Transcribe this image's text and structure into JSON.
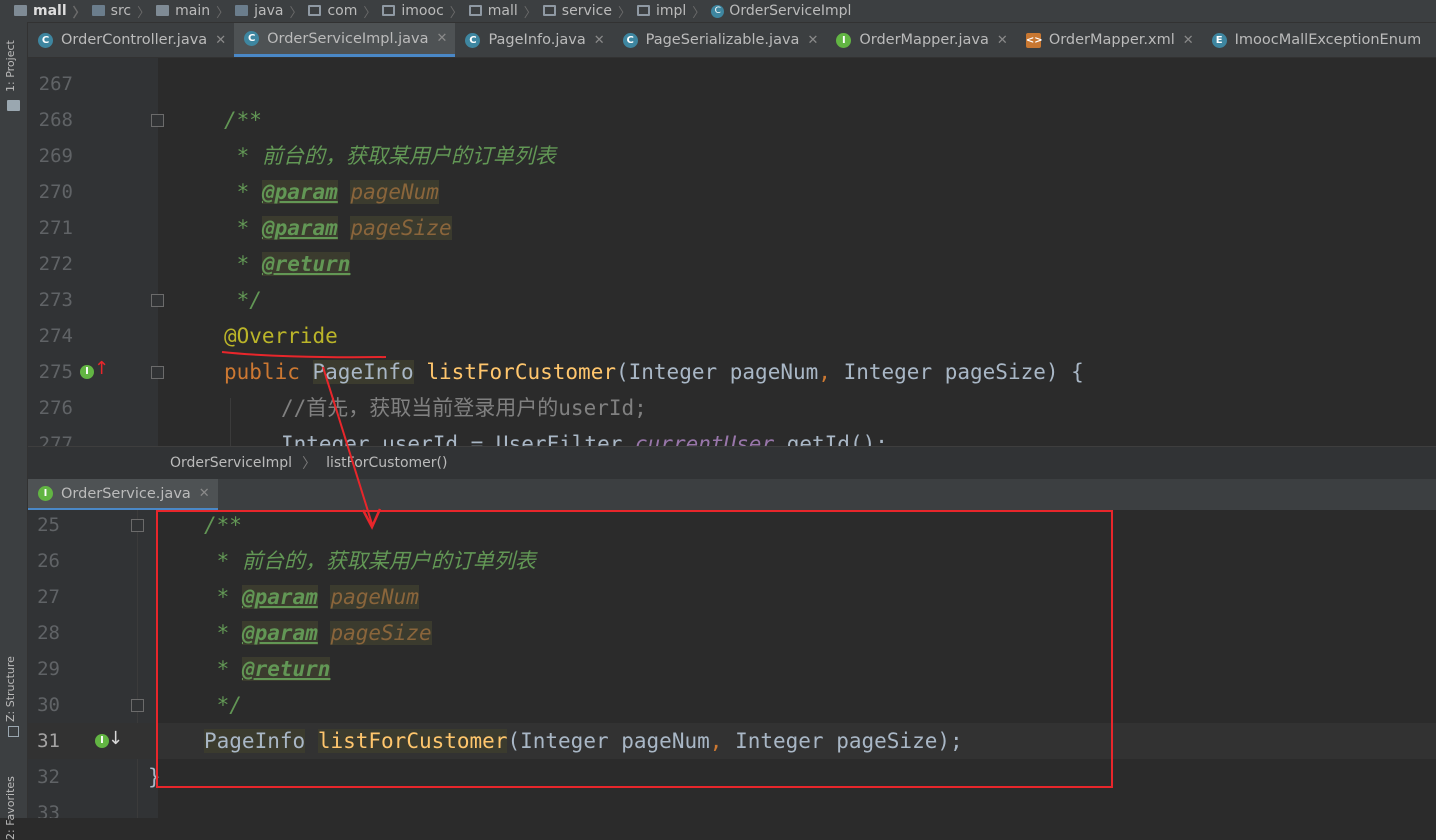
{
  "navbar": {
    "crumbs": [
      "mall",
      "src",
      "main",
      "java",
      "com",
      "imooc",
      "mall",
      "service",
      "impl",
      "OrderServiceImpl"
    ]
  },
  "toolstripe": {
    "project_label": "1: Project",
    "structure_label": "Z: Structure",
    "favorites_label": "2: Favorites"
  },
  "tabs": [
    {
      "label": "OrderController.java",
      "icon": "C"
    },
    {
      "label": "OrderServiceImpl.java",
      "icon": "C"
    },
    {
      "label": "PageInfo.java",
      "icon": "C"
    },
    {
      "label": "PageSerializable.java",
      "icon": "C"
    },
    {
      "label": "OrderMapper.java",
      "icon": "I"
    },
    {
      "label": "OrderMapper.xml",
      "icon": "X"
    },
    {
      "label": "ImoocMallExceptionEnum",
      "icon": "E"
    }
  ],
  "editor1": {
    "lines": [
      {
        "num": "267"
      },
      {
        "num": "268",
        "open": "/**"
      },
      {
        "num": "269",
        "star": " * ",
        "text": "前台的，获取某用户的订单列表"
      },
      {
        "num": "270",
        "star": " * ",
        "tag": "@param",
        "param": "pageNum"
      },
      {
        "num": "271",
        "star": " * ",
        "tag": "@param",
        "param": "pageSize"
      },
      {
        "num": "272",
        "star": " * ",
        "tag": "@return"
      },
      {
        "num": "273",
        "close": " */"
      },
      {
        "num": "274",
        "annotation": "@Override"
      },
      {
        "num": "275",
        "kw": "public",
        "type": "PageInfo",
        "fn": "listForCustomer",
        "args": "(Integer pageNum",
        "comma": ",",
        "args2": " Integer pageSize) {"
      },
      {
        "num": "276",
        "comment": "//首先，获取当前登录用户的userId;"
      },
      {
        "num": "277",
        "partial": "Integer userId = UserFilter.",
        "static": "currentUser",
        "rest": ".getId();"
      }
    ]
  },
  "editor_breadcrumb": {
    "class": "OrderServiceImpl",
    "method": "listForCustomer()"
  },
  "tab2": {
    "label": "OrderService.java",
    "icon": "I"
  },
  "editor2": {
    "lines": [
      {
        "num": "25",
        "open": "/**"
      },
      {
        "num": "26",
        "star": " * ",
        "text": "前台的，获取某用户的订单列表"
      },
      {
        "num": "27",
        "star": " * ",
        "tag": "@param",
        "param": "pageNum"
      },
      {
        "num": "28",
        "star": " * ",
        "tag": "@param",
        "param": "pageSize"
      },
      {
        "num": "29",
        "star": " * ",
        "tag": "@return"
      },
      {
        "num": "30",
        "close": " */"
      },
      {
        "num": "31",
        "type": "PageInfo",
        "fn": "listForCustomer",
        "args": "(Integer pageNum",
        "comma": ",",
        "args2": " Integer pageSize);"
      },
      {
        "num": "32",
        "brace": "}"
      },
      {
        "num": "33"
      }
    ]
  },
  "colors": {
    "annotation_red": "#e8262b",
    "comment_green": "#629755",
    "keyword_orange": "#cc7832",
    "method_yellow": "#ffc66d"
  }
}
